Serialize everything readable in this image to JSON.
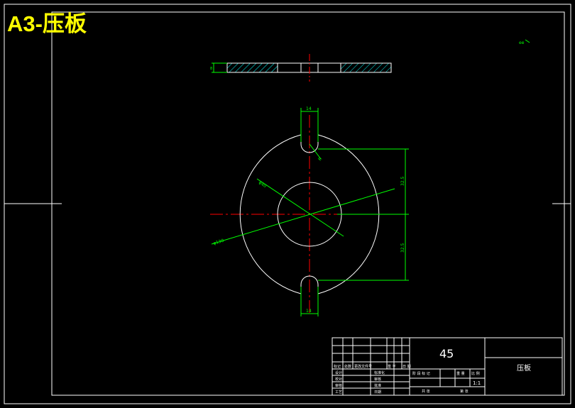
{
  "stamp": "A3-压板",
  "top_note": "ee",
  "dimensions": {
    "slot_width": "14",
    "slot_radius": "R",
    "hole_dia": "φ40",
    "outer_dia": "φ130",
    "offset": "32.5",
    "thickness": "8"
  },
  "title_block": {
    "material": "45",
    "part_name": "压板",
    "scale": "1:1",
    "rev_headers": [
      "标记",
      "处数",
      "更改文件号",
      "签 字",
      "日 期"
    ],
    "sign_rows": [
      {
        "label": "设计",
        "col": "标准化"
      },
      {
        "label": "校对",
        "col": "审核"
      },
      {
        "label": "审核",
        "col": "批准"
      },
      {
        "label": "工艺",
        "col": "日期"
      }
    ],
    "stage_headers": [
      "阶 段 标 记",
      "重 量",
      "比 例"
    ],
    "sheet_total": "共 张",
    "sheet_num": "第 张"
  },
  "colors": {
    "outline": "#ffffff",
    "dimension": "#00ff00",
    "centerline": "#ff0000",
    "hatch": "#00ffff",
    "stamp": "#ffff00"
  }
}
